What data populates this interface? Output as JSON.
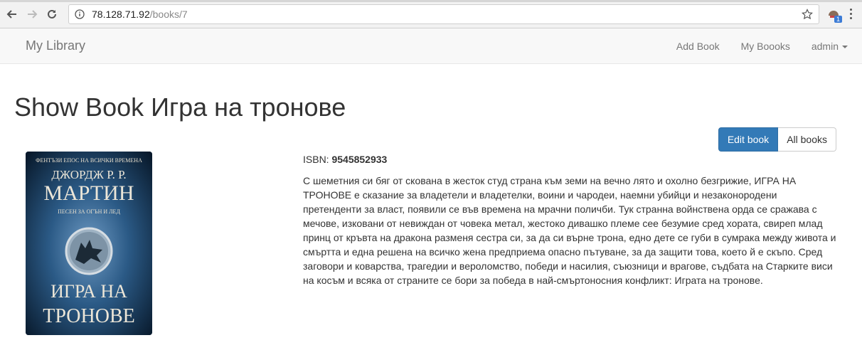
{
  "browser": {
    "url_host": "78.128.71.92",
    "url_path": "/books/7",
    "extension_badge": "1"
  },
  "navbar": {
    "brand": "My Library",
    "links": [
      "Add Book",
      "My Boooks"
    ],
    "user": "admin"
  },
  "page": {
    "title": "Show Book Игра на тронове"
  },
  "actions": {
    "edit": "Edit book",
    "all": "All books"
  },
  "book": {
    "isbn_label": "ISBN: ",
    "isbn": "9545852933",
    "description": "С шеметния си бяг от скована в жесток студ страна към земи на вечно лято и охолно безгрижие, ИГРА НА ТРОНОВЕ е сказание за владетели и владетелки, воини и чародеи, наемни убийци и незаконородени претенденти за власт, появили се във времена на мрачни поличби. Тук странна войнствена орда се сражава с мечове, изковани от невиждан от човека метал, жестоко дивашко племе сее безумие сред хората, свиреп млад принц от кръвта на дракона разменя сестра си, за да си върне трона, едно дете се губи в сумрака между живота и смъртта и една решена на всичко жена предприема опасно пътуване, за да защити това, което й е скъпо. Сред заговори и коварства, трагедии и вероломство, победи и насилия, съюзници и врагове, съдбата на Старките виси на косъм и всяка от страните се бори за победа в най-смъртоносния конфликт: Играта на тронове.",
    "cover": {
      "tagline": "ФЕНТЪЗИ ЕПОС НА ВСИЧКИ ВРЕМЕНА",
      "author_line1": "ДЖОРДЖ Р. Р.",
      "author_line2": "МАРТИН",
      "series": "ПЕСЕН ЗА ОГЪН И ЛЕД",
      "title_line1": "ИГРА НА",
      "title_line2": "ТРОНОВЕ"
    }
  },
  "colors": {
    "primary": "#337ab7",
    "navbar_bg": "#f8f8f8",
    "cover_bg": "#0e2e4a"
  }
}
